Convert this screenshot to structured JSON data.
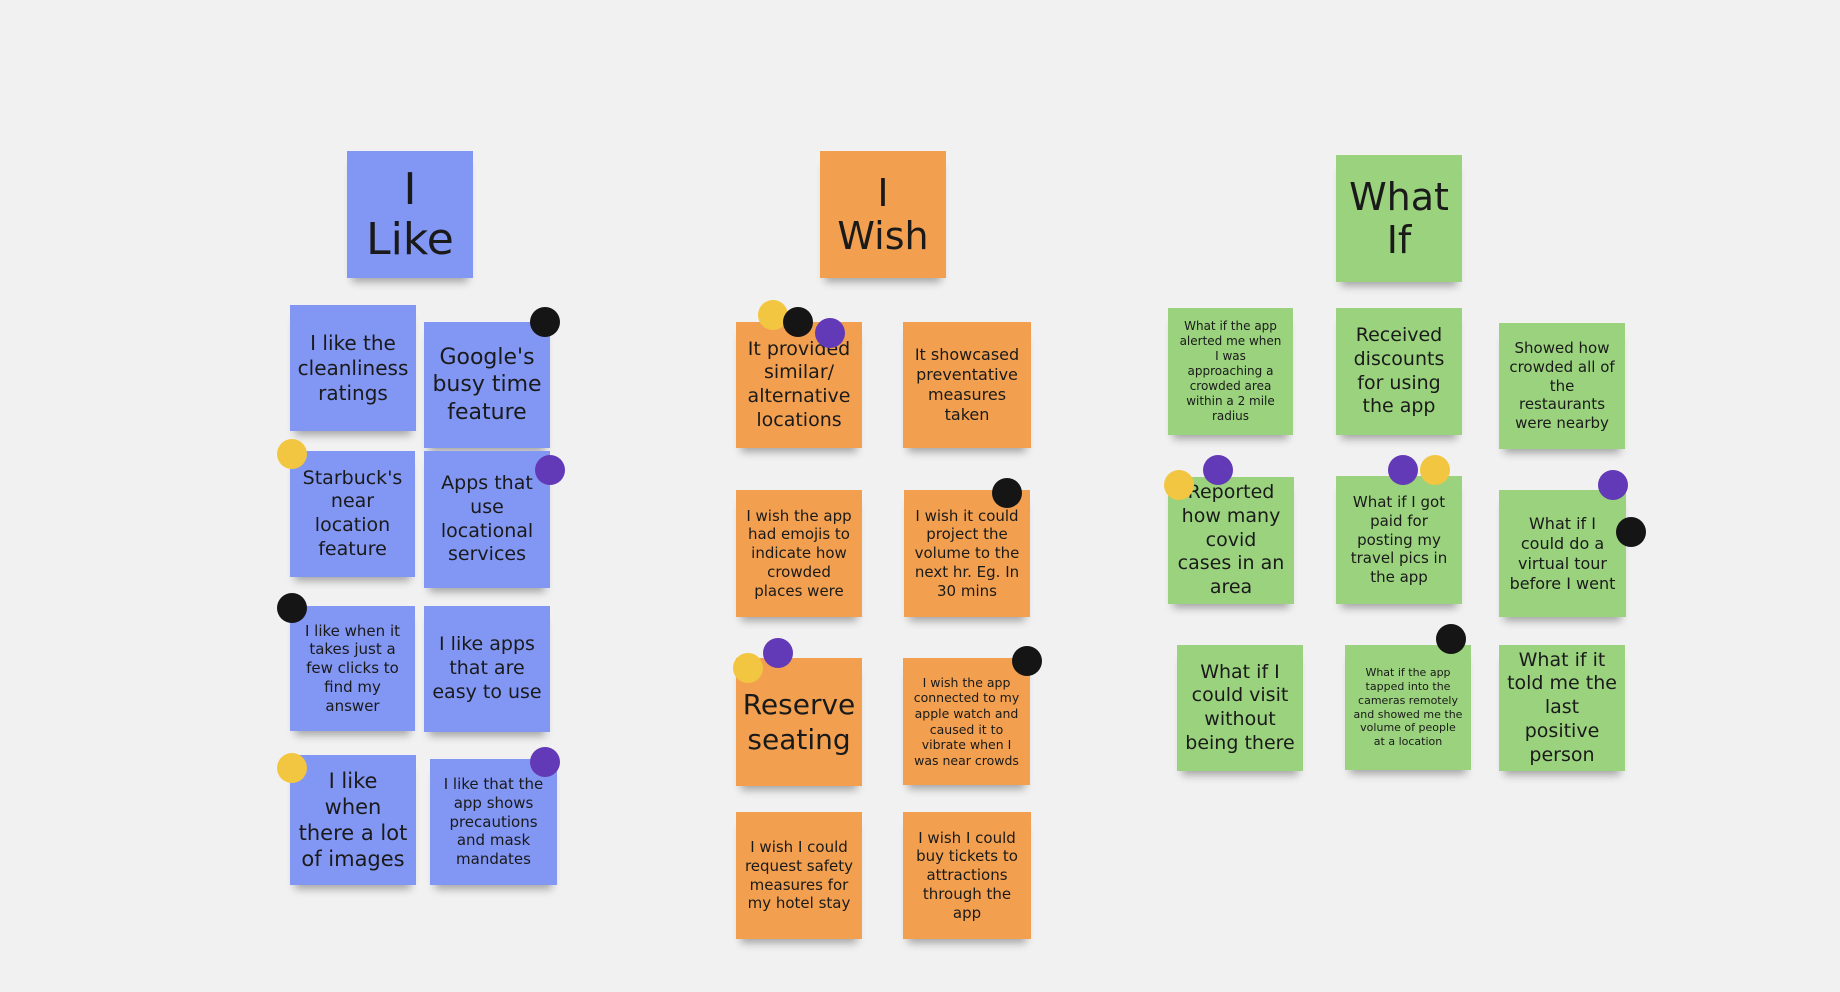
{
  "board": {
    "columns": [
      {
        "title": "I Like",
        "color": "#8296f4",
        "notes": [
          "I like the cleanliness ratings",
          "Google's busy time feature",
          "Starbuck's near location feature",
          "Apps that use locational services",
          "I like when it takes just a few clicks to find my answer",
          "I like apps that are easy to use",
          "I like when there a lot of images",
          "I like that the app shows precautions and mask mandates"
        ]
      },
      {
        "title": "I Wish",
        "color": "#f2a04f",
        "notes": [
          "It provided similar/ alternative locations",
          "It showcased preventative measures taken",
          "I wish the app had emojis to indicate how crowded places were",
          "I wish it could project the volume to the next hr. Eg. In 30 mins",
          "Reserve seating",
          "I wish the app connected to my apple watch and caused it to vibrate when I was near crowds",
          "I wish I could request safety measures for my hotel stay",
          "I wish I could buy tickets to attractions through the app"
        ]
      },
      {
        "title": "What If",
        "color": "#9ad27d",
        "notes": [
          "What if the app alerted me when I was approaching a crowded area within a 2 mile radius",
          "Received discounts for using the app",
          "Showed how crowded all of the restaurants were nearby",
          "Reported how many covid cases in an area",
          "What if I got paid for posting my travel pics in the app",
          "What if I could do a virtual tour before I went",
          "What if I could visit without being there",
          "What if the app tapped into the cameras remotely and showed me the volume of people at a location",
          "What if it told me the last positive person"
        ]
      }
    ],
    "vote_colors": {
      "yellow": "#f2c640",
      "black": "#151515",
      "purple": "#6239b6"
    },
    "votes": [
      {
        "note": "I Like / Google's busy time feature",
        "colors": [
          "black"
        ]
      },
      {
        "note": "I Like / Starbuck's near location feature",
        "colors": [
          "yellow"
        ]
      },
      {
        "note": "I Like / Apps that use locational services",
        "colors": [
          "purple"
        ]
      },
      {
        "note": "I Like / I like when it takes just a few clicks",
        "colors": [
          "black"
        ]
      },
      {
        "note": "I Like / I like when there a lot of images",
        "colors": [
          "yellow"
        ]
      },
      {
        "note": "I Like / precautions and mask mandates",
        "colors": [
          "purple"
        ]
      },
      {
        "note": "I Wish / It provided similar/ alternative locations",
        "colors": [
          "yellow",
          "black",
          "purple"
        ]
      },
      {
        "note": "I Wish / project the volume",
        "colors": [
          "black"
        ]
      },
      {
        "note": "I Wish / Reserve seating",
        "colors": [
          "yellow",
          "purple"
        ]
      },
      {
        "note": "I Wish / apple watch",
        "colors": [
          "black"
        ]
      },
      {
        "note": "What If / Reported how many covid cases",
        "colors": [
          "yellow",
          "purple"
        ]
      },
      {
        "note": "What If / paid for posting travel pics",
        "colors": [
          "purple",
          "yellow"
        ]
      },
      {
        "note": "What If / virtual tour",
        "colors": [
          "purple",
          "black"
        ]
      },
      {
        "note": "What If / cameras remotely",
        "colors": [
          "black"
        ]
      }
    ]
  }
}
